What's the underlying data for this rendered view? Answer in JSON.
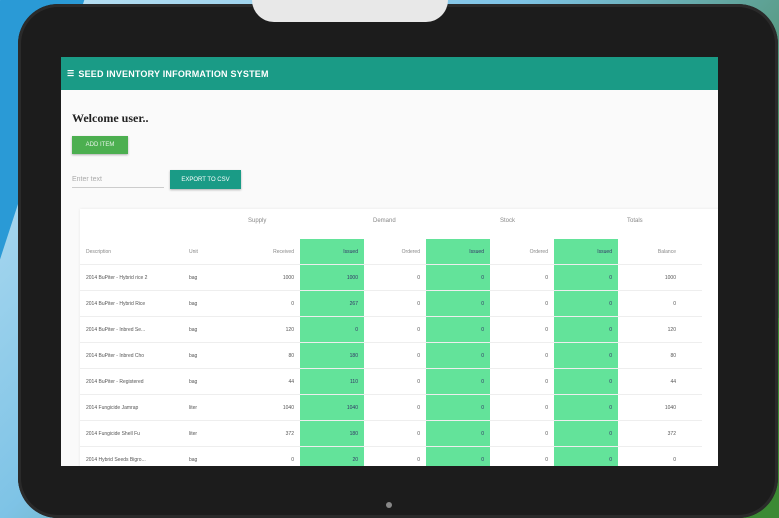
{
  "app": {
    "title": "SEED INVENTORY INFORMATION SYSTEM",
    "icon": "menu-icon"
  },
  "welcome": "Welcome user..",
  "buttons": {
    "primary_label": "ADD ITEM",
    "export_label": "EXPORT TO CSV"
  },
  "search": {
    "placeholder": "Enter text"
  },
  "groups": [
    "Supply",
    "Demand",
    "Stock",
    "Totals"
  ],
  "columns": [
    "Description",
    "Unit",
    "Received",
    "Issued",
    "Ordered",
    "Issued",
    "Ordered",
    "Issued",
    "Balance",
    ""
  ],
  "rows": [
    [
      "2014 BuPiter - Hybrid rice 2",
      "bag",
      "1000",
      "1000",
      "0",
      "0",
      "0",
      "0",
      "1000",
      ""
    ],
    [
      "2014 BuPiter - Hybrid Rice",
      "bag",
      "0",
      "267",
      "0",
      "0",
      "0",
      "0",
      "0",
      ""
    ],
    [
      "2014 BuPiter - Inbred Se...",
      "bag",
      "120",
      "0",
      "0",
      "0",
      "0",
      "0",
      "120",
      ""
    ],
    [
      "2014 BuPiter - Inbred Cho",
      "bag",
      "80",
      "180",
      "0",
      "0",
      "0",
      "0",
      "80",
      ""
    ],
    [
      "2014 BuPiter - Registered",
      "bag",
      "44",
      "110",
      "0",
      "0",
      "0",
      "0",
      "44",
      ""
    ],
    [
      "2014 Fungicide Jamrap",
      "liter",
      "1040",
      "1040",
      "0",
      "0",
      "0",
      "0",
      "1040",
      ""
    ],
    [
      "2014 Fungicide Shell Fu",
      "liter",
      "372",
      "180",
      "0",
      "0",
      "0",
      "0",
      "372",
      ""
    ],
    [
      "2014 Hybrid Seeds Bigro...",
      "bag",
      "0",
      "20",
      "0",
      "0",
      "0",
      "0",
      "0",
      ""
    ]
  ],
  "colors": {
    "accent": "#1a9b86",
    "highlight": "#63e39a",
    "button_green": "#4caf50"
  }
}
